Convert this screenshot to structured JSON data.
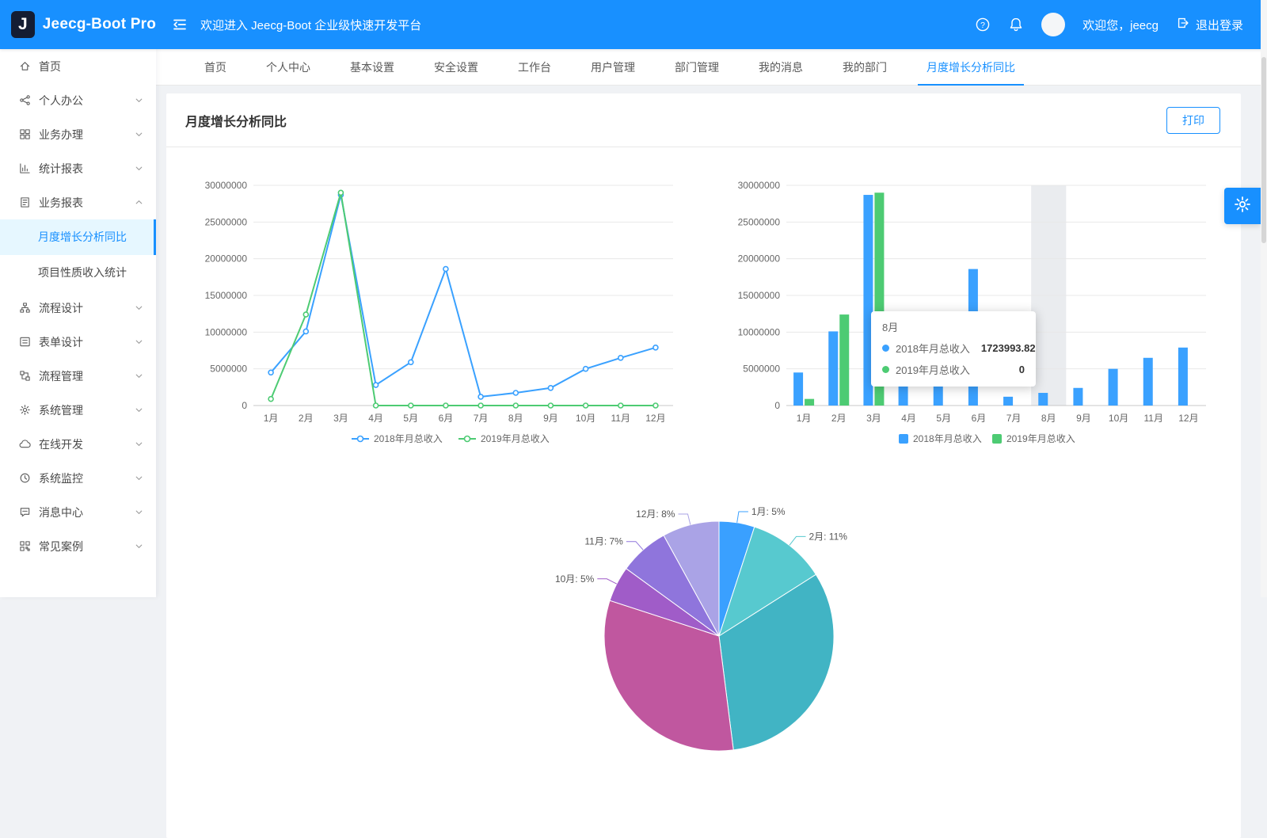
{
  "colors": {
    "primary": "#1890ff",
    "series_2018": "#3aa1ff",
    "series_2019": "#4dcb73"
  },
  "header": {
    "logo_letter": "J",
    "brand": "Jeecg-Boot Pro",
    "welcome": "欢迎进入 Jeecg-Boot 企业级快速开发平台",
    "greeting": "欢迎您，jeecg",
    "logout": "退出登录"
  },
  "sidebar": {
    "items": [
      {
        "label": "首页",
        "icon": "home"
      },
      {
        "label": "个人办公",
        "icon": "share",
        "chevron": "down"
      },
      {
        "label": "业务办理",
        "icon": "appstore",
        "chevron": "down"
      },
      {
        "label": "统计报表",
        "icon": "bar-chart",
        "chevron": "down"
      },
      {
        "label": "业务报表",
        "icon": "report",
        "chevron": "up",
        "children": [
          {
            "label": "月度增长分析同比",
            "active": true
          },
          {
            "label": "项目性质收入统计"
          }
        ]
      },
      {
        "label": "流程设计",
        "icon": "cluster",
        "chevron": "down"
      },
      {
        "label": "表单设计",
        "icon": "form",
        "chevron": "down"
      },
      {
        "label": "流程管理",
        "icon": "flow",
        "chevron": "down"
      },
      {
        "label": "系统管理",
        "icon": "gear",
        "chevron": "down"
      },
      {
        "label": "在线开发",
        "icon": "cloud",
        "chevron": "down"
      },
      {
        "label": "系统监控",
        "icon": "monitor",
        "chevron": "down"
      },
      {
        "label": "消息中心",
        "icon": "message",
        "chevron": "down"
      },
      {
        "label": "常见案例",
        "icon": "grid",
        "chevron": "down"
      }
    ]
  },
  "tabs": {
    "items": [
      {
        "label": "首页"
      },
      {
        "label": "个人中心"
      },
      {
        "label": "基本设置"
      },
      {
        "label": "安全设置"
      },
      {
        "label": "工作台"
      },
      {
        "label": "用户管理"
      },
      {
        "label": "部门管理"
      },
      {
        "label": "我的消息"
      },
      {
        "label": "我的部门"
      },
      {
        "label": "月度增长分析同比",
        "active": true
      }
    ]
  },
  "card": {
    "title": "月度增长分析同比",
    "print_button": "打印"
  },
  "chart_data": [
    {
      "type": "line",
      "categories": [
        "1月",
        "2月",
        "3月",
        "4月",
        "5月",
        "6月",
        "7月",
        "8月",
        "9月",
        "10月",
        "11月",
        "12月"
      ],
      "series": [
        {
          "name": "2018年月总收入",
          "color": "#3aa1ff",
          "values": [
            4500000,
            10100000,
            28700000,
            2800000,
            5900000,
            18600000,
            1200000,
            1723993.82,
            2400000,
            5000000,
            6500000,
            7900000
          ]
        },
        {
          "name": "2019年月总收入",
          "color": "#4dcb73",
          "values": [
            900000,
            12400000,
            29000000,
            0,
            0,
            0,
            0,
            0,
            0,
            0,
            0,
            0
          ]
        }
      ],
      "ylim": [
        0,
        30000000
      ],
      "yticks": [
        0,
        5000000,
        10000000,
        15000000,
        20000000,
        25000000,
        30000000
      ],
      "grid": true,
      "legend_position": "bottom"
    },
    {
      "type": "bar",
      "categories": [
        "1月",
        "2月",
        "3月",
        "4月",
        "5月",
        "6月",
        "7月",
        "8月",
        "9月",
        "10月",
        "11月",
        "12月"
      ],
      "series": [
        {
          "name": "2018年月总收入",
          "color": "#3aa1ff",
          "values": [
            4500000,
            10100000,
            28700000,
            2800000,
            5900000,
            18600000,
            1200000,
            1723993.82,
            2400000,
            5000000,
            6500000,
            7900000
          ]
        },
        {
          "name": "2019年月总收入",
          "color": "#4dcb73",
          "values": [
            900000,
            12400000,
            29000000,
            0,
            0,
            0,
            0,
            0,
            0,
            0,
            0,
            0
          ]
        }
      ],
      "ylim": [
        0,
        30000000
      ],
      "yticks": [
        0,
        5000000,
        10000000,
        15000000,
        20000000,
        25000000,
        30000000
      ],
      "grid": true,
      "legend_position": "bottom",
      "highlight_category": "8月",
      "tooltip": {
        "title": "8月",
        "rows": [
          {
            "color": "#3aa1ff",
            "name": "2018年月总收入",
            "value": "1723993.82"
          },
          {
            "color": "#4dcb73",
            "name": "2019年月总收入",
            "value": "0"
          }
        ]
      }
    },
    {
      "type": "pie",
      "note": "only top arc visible in viewport; labeled slices as shown",
      "slices": [
        {
          "label": "1月",
          "pct": 5,
          "color": "#3aa0ff"
        },
        {
          "label": "2月",
          "pct": 11,
          "color": "#57c9cf"
        },
        {
          "label": "",
          "pct": 32,
          "color": "#41b4c4"
        },
        {
          "label": "",
          "pct": 32,
          "color": "#c0579f"
        },
        {
          "label": "10月",
          "pct": 5,
          "color": "#a05cc8"
        },
        {
          "label": "11月",
          "pct": 7,
          "color": "#8f75dc"
        },
        {
          "label": "12月",
          "pct": 8,
          "color": "#aaa3e6"
        }
      ],
      "visible_labels": [
        "12月: 8%",
        "1月: 5%",
        "2月: 11%",
        "11月: 7%",
        "10月: 5%"
      ]
    }
  ]
}
